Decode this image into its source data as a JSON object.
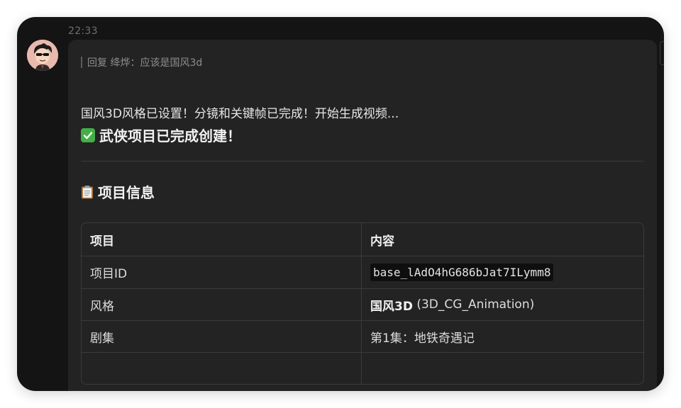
{
  "message": {
    "timestamp": "22:33",
    "reply_quote": "回复 绛烨：应该是国风3d",
    "status_text": "国风3D风格已设置！分镜和关键帧已完成！开始生成视频...",
    "done_icon": "check-mark-button-icon",
    "done_text": "武侠项目已完成创建！",
    "info_icon": "clipboard-icon",
    "info_heading": "项目信息"
  },
  "table": {
    "headers": [
      "项目",
      "内容"
    ],
    "rows": [
      {
        "label": "项目ID",
        "value": "base_lAdO4hG686bJat7ILymm8"
      },
      {
        "label": "风格",
        "value_bold": "国风3D",
        "value_rest": " (3D_CG_Animation)"
      },
      {
        "label": "剧集",
        "value": "第1集：地铁奇遇记"
      },
      {
        "label": "",
        "value": ""
      }
    ]
  },
  "colors": {
    "window_bg": "#141414",
    "bubble_bg": "#232323",
    "check_green": "#43b047",
    "border": "#3b3b3b"
  }
}
